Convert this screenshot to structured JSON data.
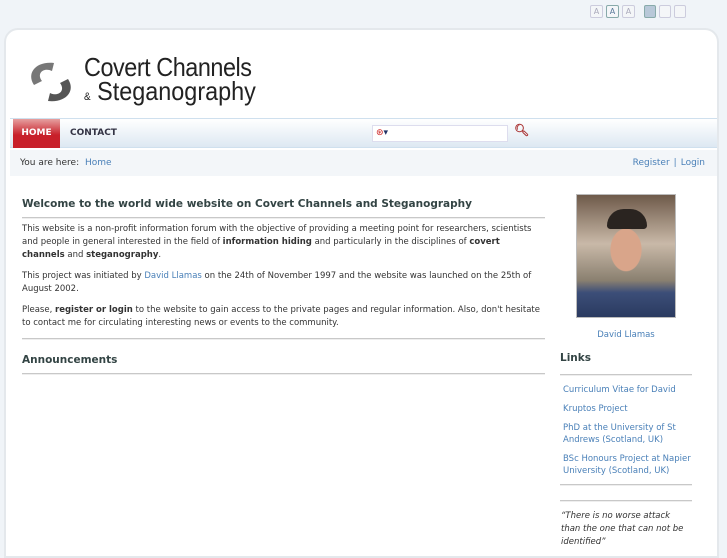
{
  "toolbar": {
    "font_small": "A",
    "font_medium": "A",
    "font_large": "A"
  },
  "logo": {
    "line1": "Covert Channels",
    "amp": "&",
    "line2": "Steganography"
  },
  "nav": {
    "items": [
      {
        "label": "HOME"
      },
      {
        "label": "CONTACT"
      }
    ],
    "search_placeholder": ""
  },
  "breadcrumb": {
    "label": "You are here:",
    "home": "Home",
    "register": "Register",
    "sep": "|",
    "login": "Login"
  },
  "main": {
    "title": "Welcome to the world wide website on Covert Channels and Steganography",
    "p1a": "This website is a non-profit information forum with the objective of providing a meeting point for researchers, scientists and people in general interested in the field of ",
    "p1b": "information hiding",
    "p1c": " and particularly in the disciplines of ",
    "p1d": "covert channels",
    "p1e": " and ",
    "p1f": "steganography",
    "p1g": ".",
    "p2a": "This project was initiated by ",
    "p2link": "David Llamas",
    "p2b": " on the 24th of November 1997 and the website was launched on the 25th of August 2002.",
    "p3a": "Please, ",
    "p3b": "register or login",
    "p3c": " to the website to gain access to the private pages and regular information. Also, don't hesitate to contact me for circulating interesting news or events to the community.",
    "announcements": "Announcements"
  },
  "sidebar": {
    "photo_caption": "David Llamas",
    "links_title": "Links",
    "links": [
      {
        "label": "Curriculum Vitae for David"
      },
      {
        "label": "Kruptos Project"
      },
      {
        "label": "PhD at the University of St Andrews (Scotland, UK)"
      },
      {
        "label": "BSc Honours Project at Napier University (Scotland, UK)"
      }
    ],
    "quote": "“There is no worse attack than the one that can not be identified”"
  }
}
